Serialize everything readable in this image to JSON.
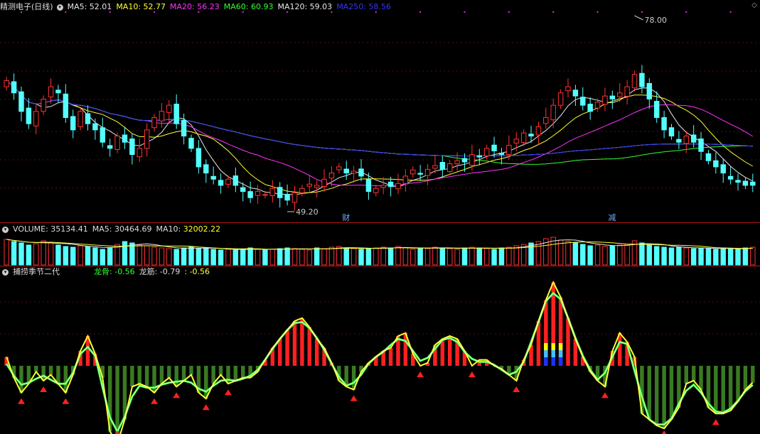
{
  "stock": {
    "name": "精测电子",
    "period": "(日线)"
  },
  "price_panel": {
    "indicators": [
      {
        "label": "MA5:",
        "value": "52.01",
        "color": "#e6e6e6"
      },
      {
        "label": "MA10:",
        "value": "52.77",
        "color": "#ffff33"
      },
      {
        "label": "MA20:",
        "value": "56.23",
        "color": "#ff33ff"
      },
      {
        "label": "MA60:",
        "value": "60.93",
        "color": "#33ff33"
      },
      {
        "label": "MA120:",
        "value": "59.03",
        "color": "#e6e6e6"
      },
      {
        "label": "MA250:",
        "value": "58.56",
        "color": "#3333ff"
      }
    ],
    "high_marker": "78.00",
    "low_marker": "49.20",
    "event_labels": [
      "财",
      "减"
    ]
  },
  "volume_panel": {
    "title": "VOLUME: 35134.41",
    "ma5": "MA5: 30464.69",
    "ma10_label": "MA10:",
    "ma10_value": "32002.22"
  },
  "indicator_panel": {
    "title": "捕捞季节二代",
    "l1_label": "龙骨:",
    "l1_value": "-0.56",
    "l2_label": "龙筋:",
    "l2_value": "-0.79",
    "l3_value": ": -0.56"
  },
  "colors": {
    "up": "#ff3232",
    "down": "#54ffff",
    "ma5": "#e6e6e6",
    "ma10": "#ffff33",
    "ma20": "#ff33ff",
    "ma60": "#33ff33",
    "ma120": "#e6e6e6",
    "ma250": "#3333ff"
  },
  "chart_data": {
    "type": "candlestick",
    "n_bars": 102,
    "price_axis": {
      "ylim": [
        47.5,
        80
      ]
    },
    "close": [
      69,
      67,
      64,
      62,
      64,
      66,
      68,
      67,
      63,
      61,
      64,
      62,
      61,
      59,
      58,
      60,
      59,
      57,
      58,
      61,
      63,
      64,
      65,
      62,
      60,
      58,
      55,
      54,
      53,
      52,
      53,
      52,
      51,
      50,
      51,
      50.5,
      51.5,
      50,
      49.6,
      50.8,
      51.5,
      52.2,
      52,
      53,
      54,
      55,
      54,
      54.3,
      53.5,
      51,
      51.5,
      52,
      51.8,
      52.3,
      53.5,
      54.5,
      53.8,
      54.6,
      55.2,
      54.6,
      55.5,
      56,
      55.8,
      57,
      56.6,
      58,
      57.6,
      57,
      58.5,
      59.5,
      60.5,
      60,
      61.5,
      63,
      65,
      67,
      68,
      66.5,
      65,
      64,
      65.5,
      66.5,
      66,
      67,
      68,
      70,
      68,
      66,
      63,
      61,
      60,
      59,
      60,
      59,
      57.5,
      56,
      55,
      54,
      53,
      52.5,
      52,
      52.01
    ],
    "volume": [
      36,
      33,
      31,
      28,
      30,
      34,
      32,
      28,
      26,
      25,
      27,
      26,
      24,
      22,
      24,
      29,
      33,
      31,
      28,
      27,
      25,
      24,
      23,
      22,
      24,
      26,
      23,
      24,
      22,
      21,
      22,
      21,
      22,
      24,
      22,
      21,
      22,
      23,
      24,
      23,
      22,
      21,
      24,
      23,
      25,
      26,
      24,
      23,
      22,
      23,
      24,
      25,
      24,
      26,
      24,
      22,
      24,
      23,
      25,
      24,
      23,
      22,
      24,
      25,
      24,
      23,
      22,
      24,
      25,
      27,
      29,
      31,
      33,
      37,
      39,
      35,
      33,
      31,
      29,
      27,
      28,
      26,
      27,
      28,
      29,
      34,
      31,
      28,
      26,
      25,
      24,
      25,
      24,
      23,
      24,
      23,
      22,
      24,
      23,
      22,
      24,
      25
    ],
    "indicator": [
      0.3,
      -0.4,
      -0.9,
      -0.6,
      -0.2,
      -0.5,
      -0.3,
      -0.6,
      -0.9,
      -0.3,
      0.5,
      1.0,
      0.4,
      -0.4,
      -2.2,
      -2.6,
      -1.8,
      -0.7,
      -0.6,
      -0.7,
      -0.9,
      -0.6,
      -0.4,
      -0.7,
      -0.5,
      -0.3,
      -0.9,
      -1.1,
      -0.6,
      -0.3,
      -0.6,
      -0.5,
      -0.4,
      -0.4,
      -0.2,
      0.2,
      0.6,
      0.9,
      1.2,
      1.5,
      1.6,
      1.3,
      0.9,
      0.6,
      0.1,
      -0.5,
      -0.7,
      -0.8,
      -0.2,
      0.1,
      0.3,
      0.5,
      0.6,
      1.0,
      1.1,
      0.4,
      0.0,
      0.1,
      0.7,
      0.9,
      1.0,
      0.9,
      0.5,
      0.0,
      0.2,
      0.2,
      0.0,
      -0.1,
      -0.3,
      -0.5,
      0.2,
      0.7,
      1.5,
      2.2,
      2.8,
      2.3,
      1.6,
      0.9,
      0.3,
      -0.2,
      -0.5,
      -0.7,
      0.5,
      1.1,
      0.8,
      0.3,
      -1.6,
      -1.8,
      -2.0,
      -2.1,
      -1.8,
      -1.4,
      -0.6,
      -0.5,
      -0.8,
      -1.4,
      -1.6,
      -1.6,
      -1.5,
      -1.2,
      -0.8,
      -0.56
    ]
  }
}
